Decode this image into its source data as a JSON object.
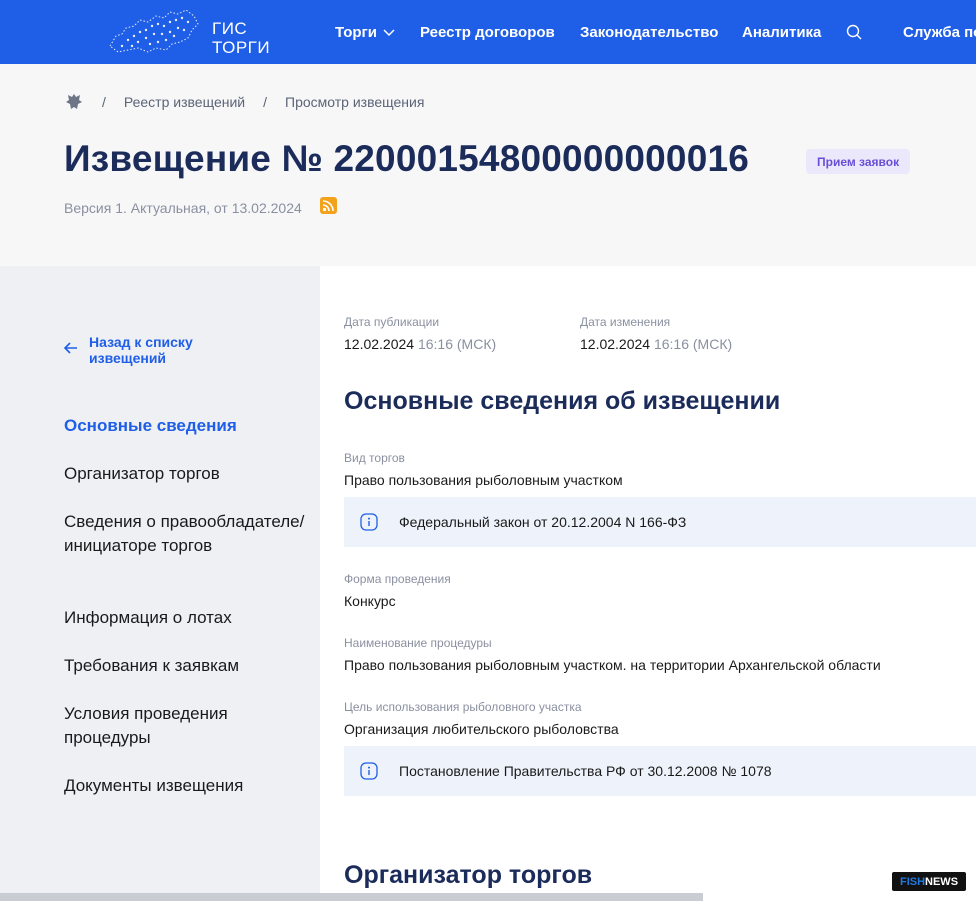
{
  "header": {
    "logo_line1": "ГИС",
    "logo_line2": "ТОРГИ",
    "nav": {
      "torgi": "Торги",
      "reestr": "Реестр договоров",
      "zakon": "Законодательство",
      "analitika": "Аналитика",
      "service": "Служба по"
    }
  },
  "breadcrumb": {
    "sep1": "/",
    "item1": "Реестр извещений",
    "sep2": "/",
    "item2": "Просмотр извещения"
  },
  "page": {
    "title": "Извещение № 22000154800000000016",
    "status": "Прием заявок",
    "version": "Версия 1. Актуальная, от 13.02.2024"
  },
  "sidebar": {
    "back": "Назад к списку извещений",
    "items": [
      "Основные сведения",
      "Организатор торгов",
      "Сведения о правообладателе/инициаторе торгов",
      "Информация о лотах",
      "Требования к заявкам",
      "Условия проведения процедуры",
      "Документы извещения"
    ]
  },
  "content": {
    "pub_label": "Дата публикации",
    "pub_date": "12.02.2024",
    "pub_time": "16:16 (МСК)",
    "mod_label": "Дата изменения",
    "mod_date": "12.02.2024",
    "mod_time": "16:16 (МСК)",
    "section_title": "Основные сведения об извещении",
    "vid_label": "Вид торгов",
    "vid_value": "Право пользования рыболовным участком",
    "info1": "Федеральный закон от 20.12.2004 N 166-ФЗ",
    "forma_label": "Форма проведения",
    "forma_value": "Конкурс",
    "naim_label": "Наименование процедуры",
    "naim_value": "Право пользования рыболовным участком. на территории Архангельской области",
    "cel_label": "Цель использования рыболовного участка",
    "cel_value": "Организация любительского рыболовства",
    "info2": "Постановление Правительства РФ от 30.12.2008 № 1078",
    "section2_title": "Организатор торгов"
  },
  "watermark": {
    "fish": "FISH",
    "news": "NEWS"
  },
  "colors": {
    "brand": "#1f5ee6",
    "title": "#1b2b5a",
    "badge_bg": "#ebe8fb",
    "badge_text": "#6a4fd6"
  }
}
